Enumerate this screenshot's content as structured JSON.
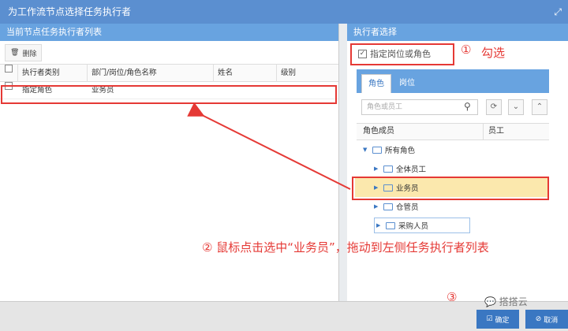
{
  "window": {
    "title": "为工作流节点选择任务执行者",
    "expand_icon": "expand-icon"
  },
  "left": {
    "header": "当前节点任务执行者列表",
    "delete_label": "删除",
    "columns": [
      "执行者类别",
      "部门/岗位/角色名称",
      "姓名",
      "级别"
    ],
    "rows": [
      {
        "type": "指定角色",
        "name": "业务员"
      }
    ]
  },
  "right": {
    "header": "执行者选择",
    "checkbox_label": "指定岗位或角色",
    "tabs": [
      "角色",
      "岗位"
    ],
    "search_placeholder": "角色或员工",
    "tree_columns": [
      "角色成员",
      "员工"
    ],
    "tree": {
      "root": "所有角色",
      "items": [
        "全体员工",
        "业务员",
        "仓管员",
        "采购人员"
      ]
    }
  },
  "annotations": {
    "step1_num": "①",
    "step1_text": "勾选",
    "step2": "② 鼠标点击选中“业务员”，拖动到左侧任务执行者列表",
    "step3_num": "③"
  },
  "footer": {
    "ok_label": "确定",
    "cancel_label": "取消",
    "watermark": "搭搭云"
  },
  "colors": {
    "accent": "#5b8fd0",
    "highlight": "#fbe8ad",
    "annotation": "#e53935"
  }
}
